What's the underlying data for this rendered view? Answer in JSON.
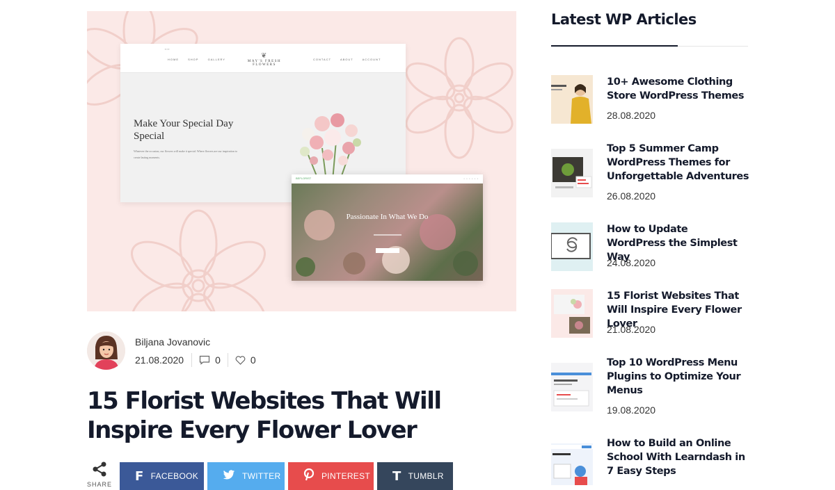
{
  "hero": {
    "mock_nav_links_left": [
      "HOME",
      "SHOP",
      "GALLERY"
    ],
    "mock_nav_links_right": [
      "CONTACT",
      "ABOUT",
      "ACCOUNT"
    ],
    "mock_logo": "MAY'S FRESH FLOWERS",
    "mock_heading": "Make Your Special Day Special",
    "mock_sub": "Whatever the occasion, our flowers will make it special. Where flowers are our inspiration to create lasting moments.",
    "mock2_logo": "BEFLORIST",
    "mock2_title": "Passionate In What We Do"
  },
  "author": {
    "name": "Biljana Jovanovic",
    "date": "21.08.2020",
    "comments": "0",
    "likes": "0"
  },
  "post": {
    "title": "15 Florist Websites That Will Inspire Every Flower Lover"
  },
  "share": {
    "label": "SHARE",
    "facebook": "FACEBOOK",
    "twitter": "TWITTER",
    "pinterest": "PINTEREST",
    "tumblr": "TUMBLR"
  },
  "colors": {
    "facebook": "#3b5998",
    "twitter": "#55acee",
    "pinterest": "#e74c4c",
    "tumblr": "#35465c",
    "hero_bg": "#fbe9e7"
  },
  "sidebar": {
    "title": "Latest WP Articles",
    "articles": [
      {
        "title": "10+ Awesome Clothing Store WordPress Themes",
        "date": "28.08.2020"
      },
      {
        "title": "Top 5 Summer Camp WordPress Themes for Unforgettable Adventures",
        "date": "26.08.2020"
      },
      {
        "title": "How to Update WordPress the Simplest Way",
        "date": "24.08.2020"
      },
      {
        "title": "15 Florist Websites That Will Inspire Every Flower Lover",
        "date": "21.08.2020"
      },
      {
        "title": "Top 10 WordPress Menu Plugins to Optimize Your Menus",
        "date": "19.08.2020"
      },
      {
        "title": "How to Build an Online School With Learndash in 7 Easy Steps",
        "date": ""
      }
    ]
  }
}
